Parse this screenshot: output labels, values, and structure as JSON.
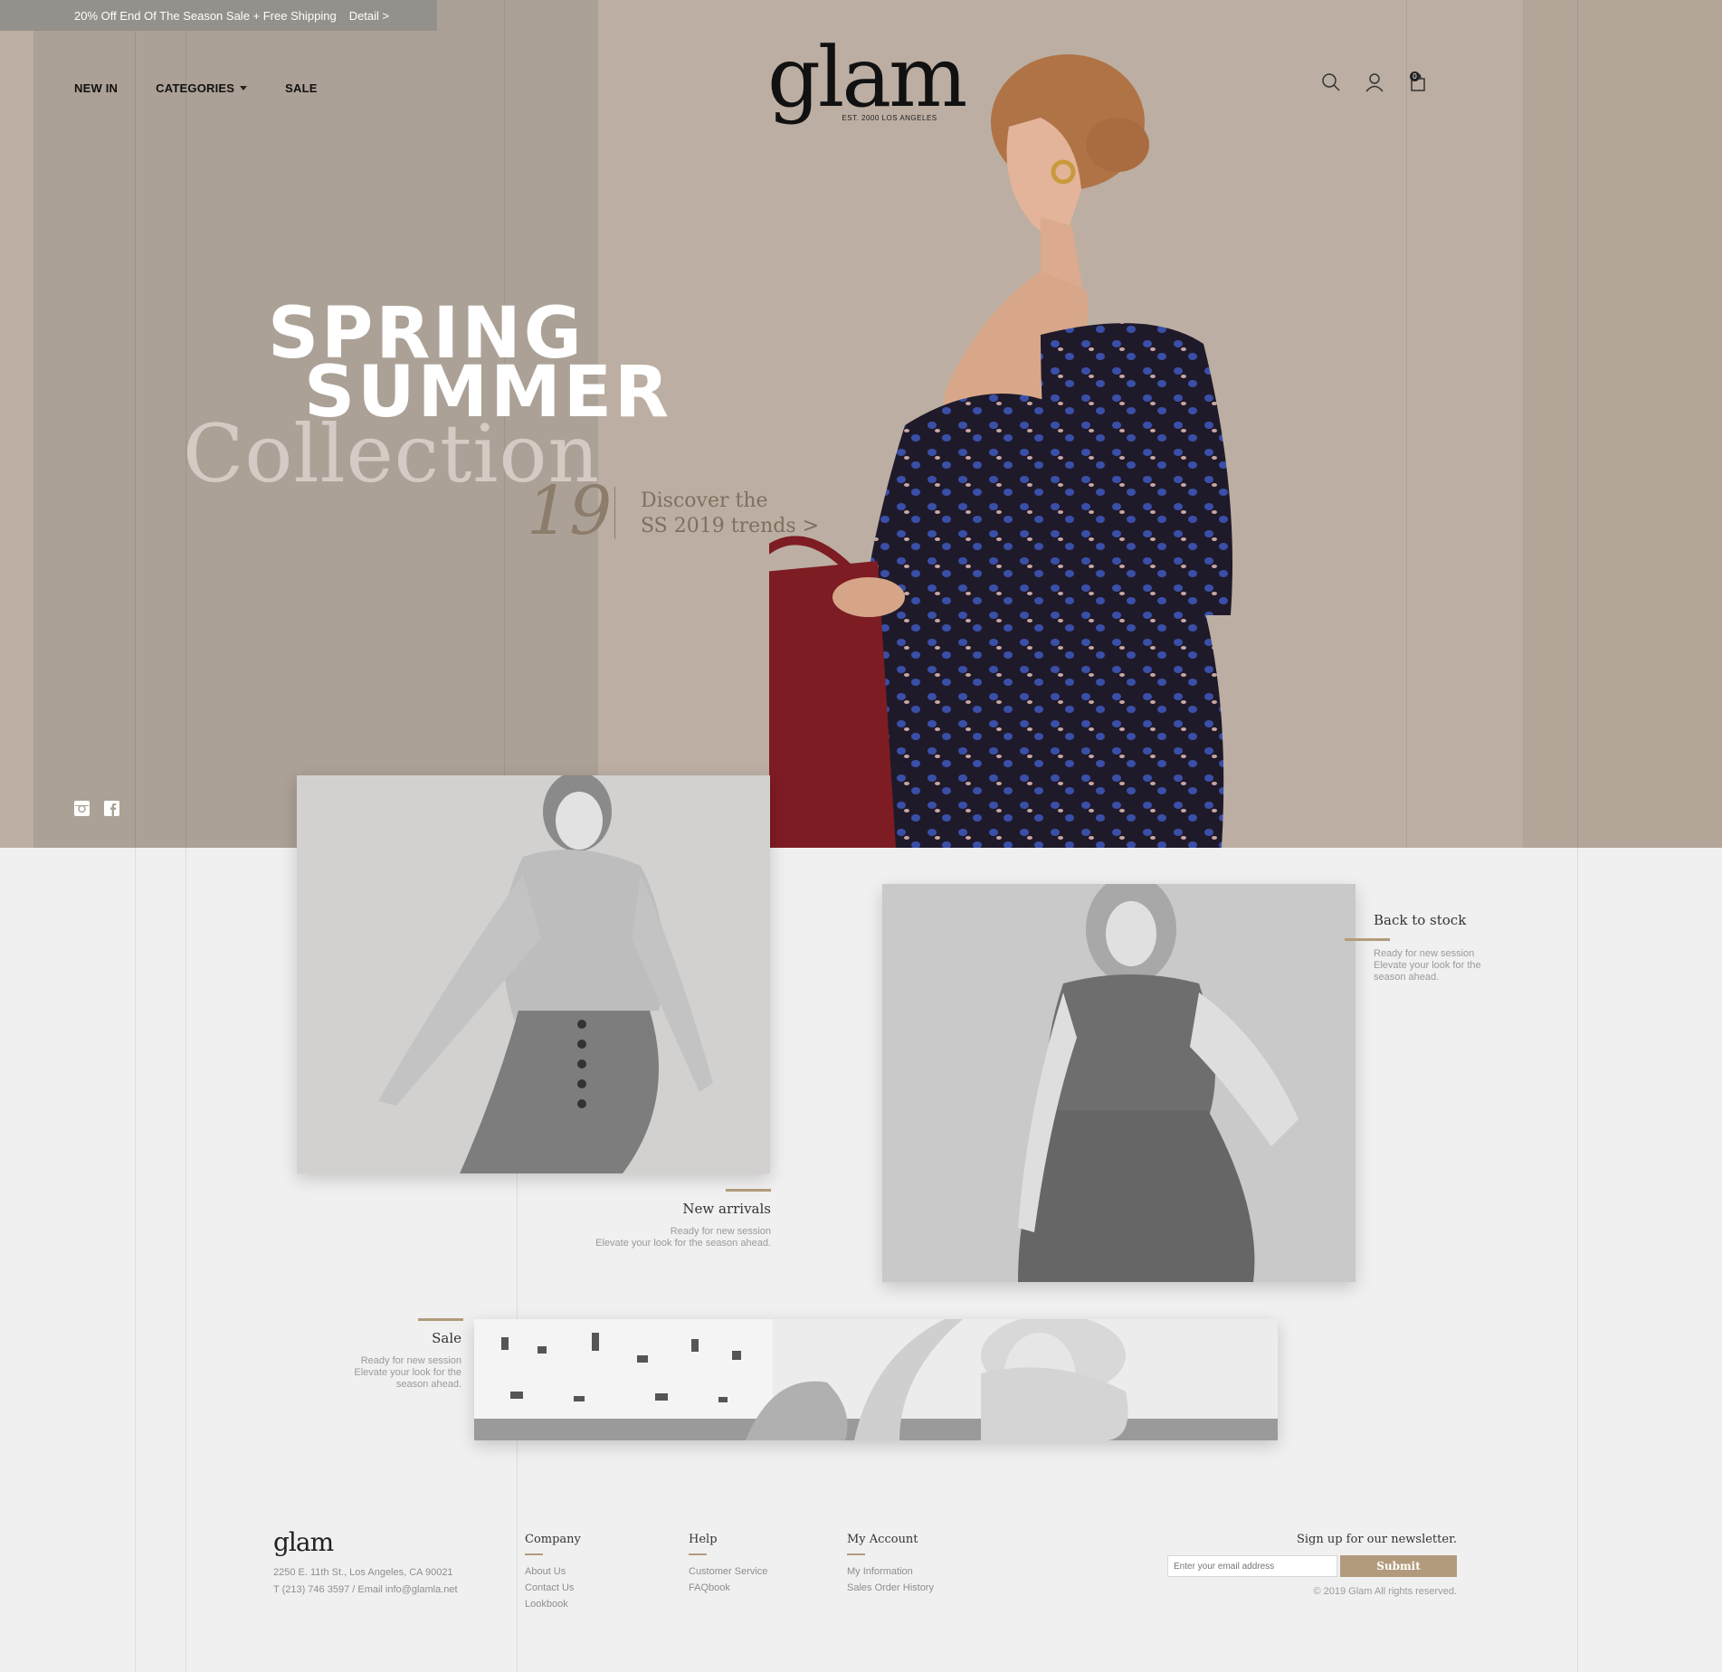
{
  "promo": {
    "text": "20% Off End Of The Season Sale + Free Shipping",
    "link": "Detail >"
  },
  "nav": [
    {
      "label": "NEW IN"
    },
    {
      "label": "CATEGORIES"
    },
    {
      "label": "SALE"
    }
  ],
  "logo": {
    "word": "glam",
    "sub": "EST. 2000   LOS ANGELES"
  },
  "header_icons": {
    "search": "search-icon",
    "account": "user-icon",
    "cart": "shopping-bag-icon",
    "cart_count": "0"
  },
  "hero": {
    "line1": "SPRING",
    "line2": "SUMMER",
    "line3": "Collection",
    "year": "19",
    "cta_line1": "Discover the",
    "cta_line2": "SS 2019 trends >"
  },
  "social": [
    "instagram-icon",
    "facebook-icon"
  ],
  "cards": [
    {
      "title": "New arrivals",
      "text1": "Ready for new session",
      "text2": "Elevate your look for the season ahead."
    },
    {
      "title": "Back to stock",
      "text1": "Ready for new session",
      "text2": "Elevate your look for the",
      "text3": "season ahead."
    },
    {
      "title": "Sale",
      "text1": "Ready for new session",
      "text2": "Elevate your look for the",
      "text3": "season ahead."
    }
  ],
  "footer": {
    "logo": "glam",
    "address": "2250 E. 11th St., Los Angeles, CA 90021",
    "contact": "T (213) 746 3597 / Email info@glamla.net",
    "columns": [
      {
        "title": "Company",
        "links": [
          "About Us",
          "Contact Us",
          "Lookbook"
        ]
      },
      {
        "title": "Help",
        "links": [
          "Customer Service",
          "FAQbook"
        ]
      },
      {
        "title": "My Account",
        "links": [
          "My Information",
          "Sales Order History"
        ]
      }
    ],
    "newsletter": {
      "title": "Sign up for our newsletter.",
      "placeholder": "Enter your email address",
      "button": "Submit",
      "copyright": "© 2019 Glam All rights reserved."
    }
  },
  "colors": {
    "accent": "#b29b7c",
    "hero_bg": "#bcaea2",
    "page_bg": "#f1f0f0"
  }
}
